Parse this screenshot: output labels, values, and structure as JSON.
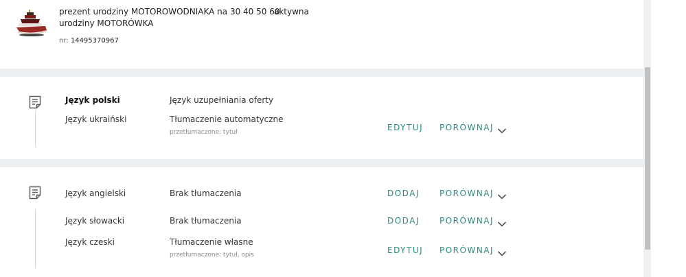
{
  "offer": {
    "title": "prezent urodziny MOTOROWODNIAKA na 30 40 50 60",
    "status": "aktywna",
    "subtitle": "urodziny MOTORÓWKA",
    "nr_label": "nr:",
    "nr_value": "14495370967",
    "thumbnail_icon": "boat-cake-thumbnail"
  },
  "groups": [
    {
      "icon": "document-icon",
      "rows": [
        {
          "language": "Język polski",
          "status": "Język uzupełniania oferty",
          "bold": true
        },
        {
          "language": "Język ukraiński",
          "status": "Tłumaczenie automatyczne",
          "detail": "przetłumaczone: tytuł",
          "action": "EDYTUJ",
          "compare": "PORÓWNAJ"
        }
      ]
    },
    {
      "icon": "document-icon",
      "rows": [
        {
          "language": "Język angielski",
          "status": "Brak tłumaczenia",
          "action": "DODAJ",
          "compare": "PORÓWNAJ"
        },
        {
          "language": "Język słowacki",
          "status": "Brak tłumaczenia",
          "action": "DODAJ",
          "compare": "PORÓWNAJ"
        },
        {
          "language": "Język czeski",
          "status": "Tłumaczenie własne",
          "detail": "przetłumaczone: tytuł, opis",
          "action": "EDYTUJ",
          "compare": "PORÓWNAJ"
        }
      ]
    }
  ],
  "colors": {
    "accent": "#2a8a80",
    "separator": "#eceff2",
    "scrollbar_thumb": "#c1c1c1"
  }
}
